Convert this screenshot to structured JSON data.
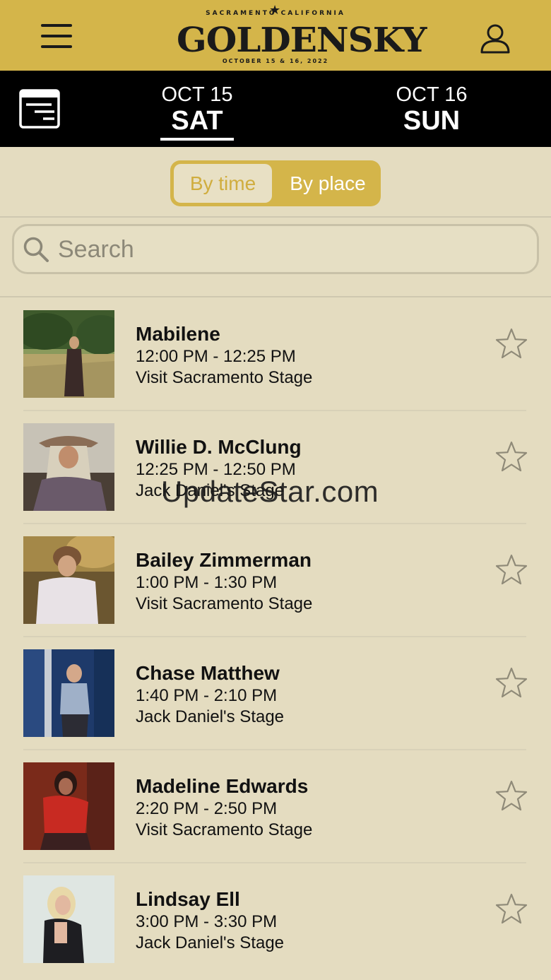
{
  "header": {
    "logo_top": "SACRAMENTO CALIFORNIA",
    "logo_main": "GOLDENSKY",
    "logo_bottom": "OCTOBER 15 & 16, 2022",
    "bg_color": "#d4b54a"
  },
  "days": [
    {
      "date": "OCT 15",
      "name": "SAT",
      "selected": true
    },
    {
      "date": "OCT 16",
      "name": "SUN",
      "selected": false
    }
  ],
  "segment": {
    "time_label": "By time",
    "place_label": "By place",
    "selected": "By time"
  },
  "search": {
    "placeholder": "Search"
  },
  "performances": [
    {
      "name": "Mabilene",
      "time": "12:00 PM - 12:25 PM",
      "stage": "Visit Sacramento Stage",
      "favorite": false
    },
    {
      "name": "Willie D. McClung",
      "time": "12:25 PM - 12:50 PM",
      "stage": "Jack Daniel's Stage",
      "favorite": false
    },
    {
      "name": "Bailey Zimmerman",
      "time": "1:00 PM - 1:30 PM",
      "stage": "Visit Sacramento Stage",
      "favorite": false
    },
    {
      "name": "Chase Matthew",
      "time": "1:40 PM - 2:10 PM",
      "stage": "Jack Daniel's Stage",
      "favorite": false
    },
    {
      "name": "Madeline Edwards",
      "time": "2:20 PM - 2:50 PM",
      "stage": "Visit Sacramento Stage",
      "favorite": false
    },
    {
      "name": "Lindsay Ell",
      "time": "3:00 PM - 3:30 PM",
      "stage": "Jack Daniel's Stage",
      "favorite": false
    }
  ],
  "watermark": "UpdateStar.com"
}
